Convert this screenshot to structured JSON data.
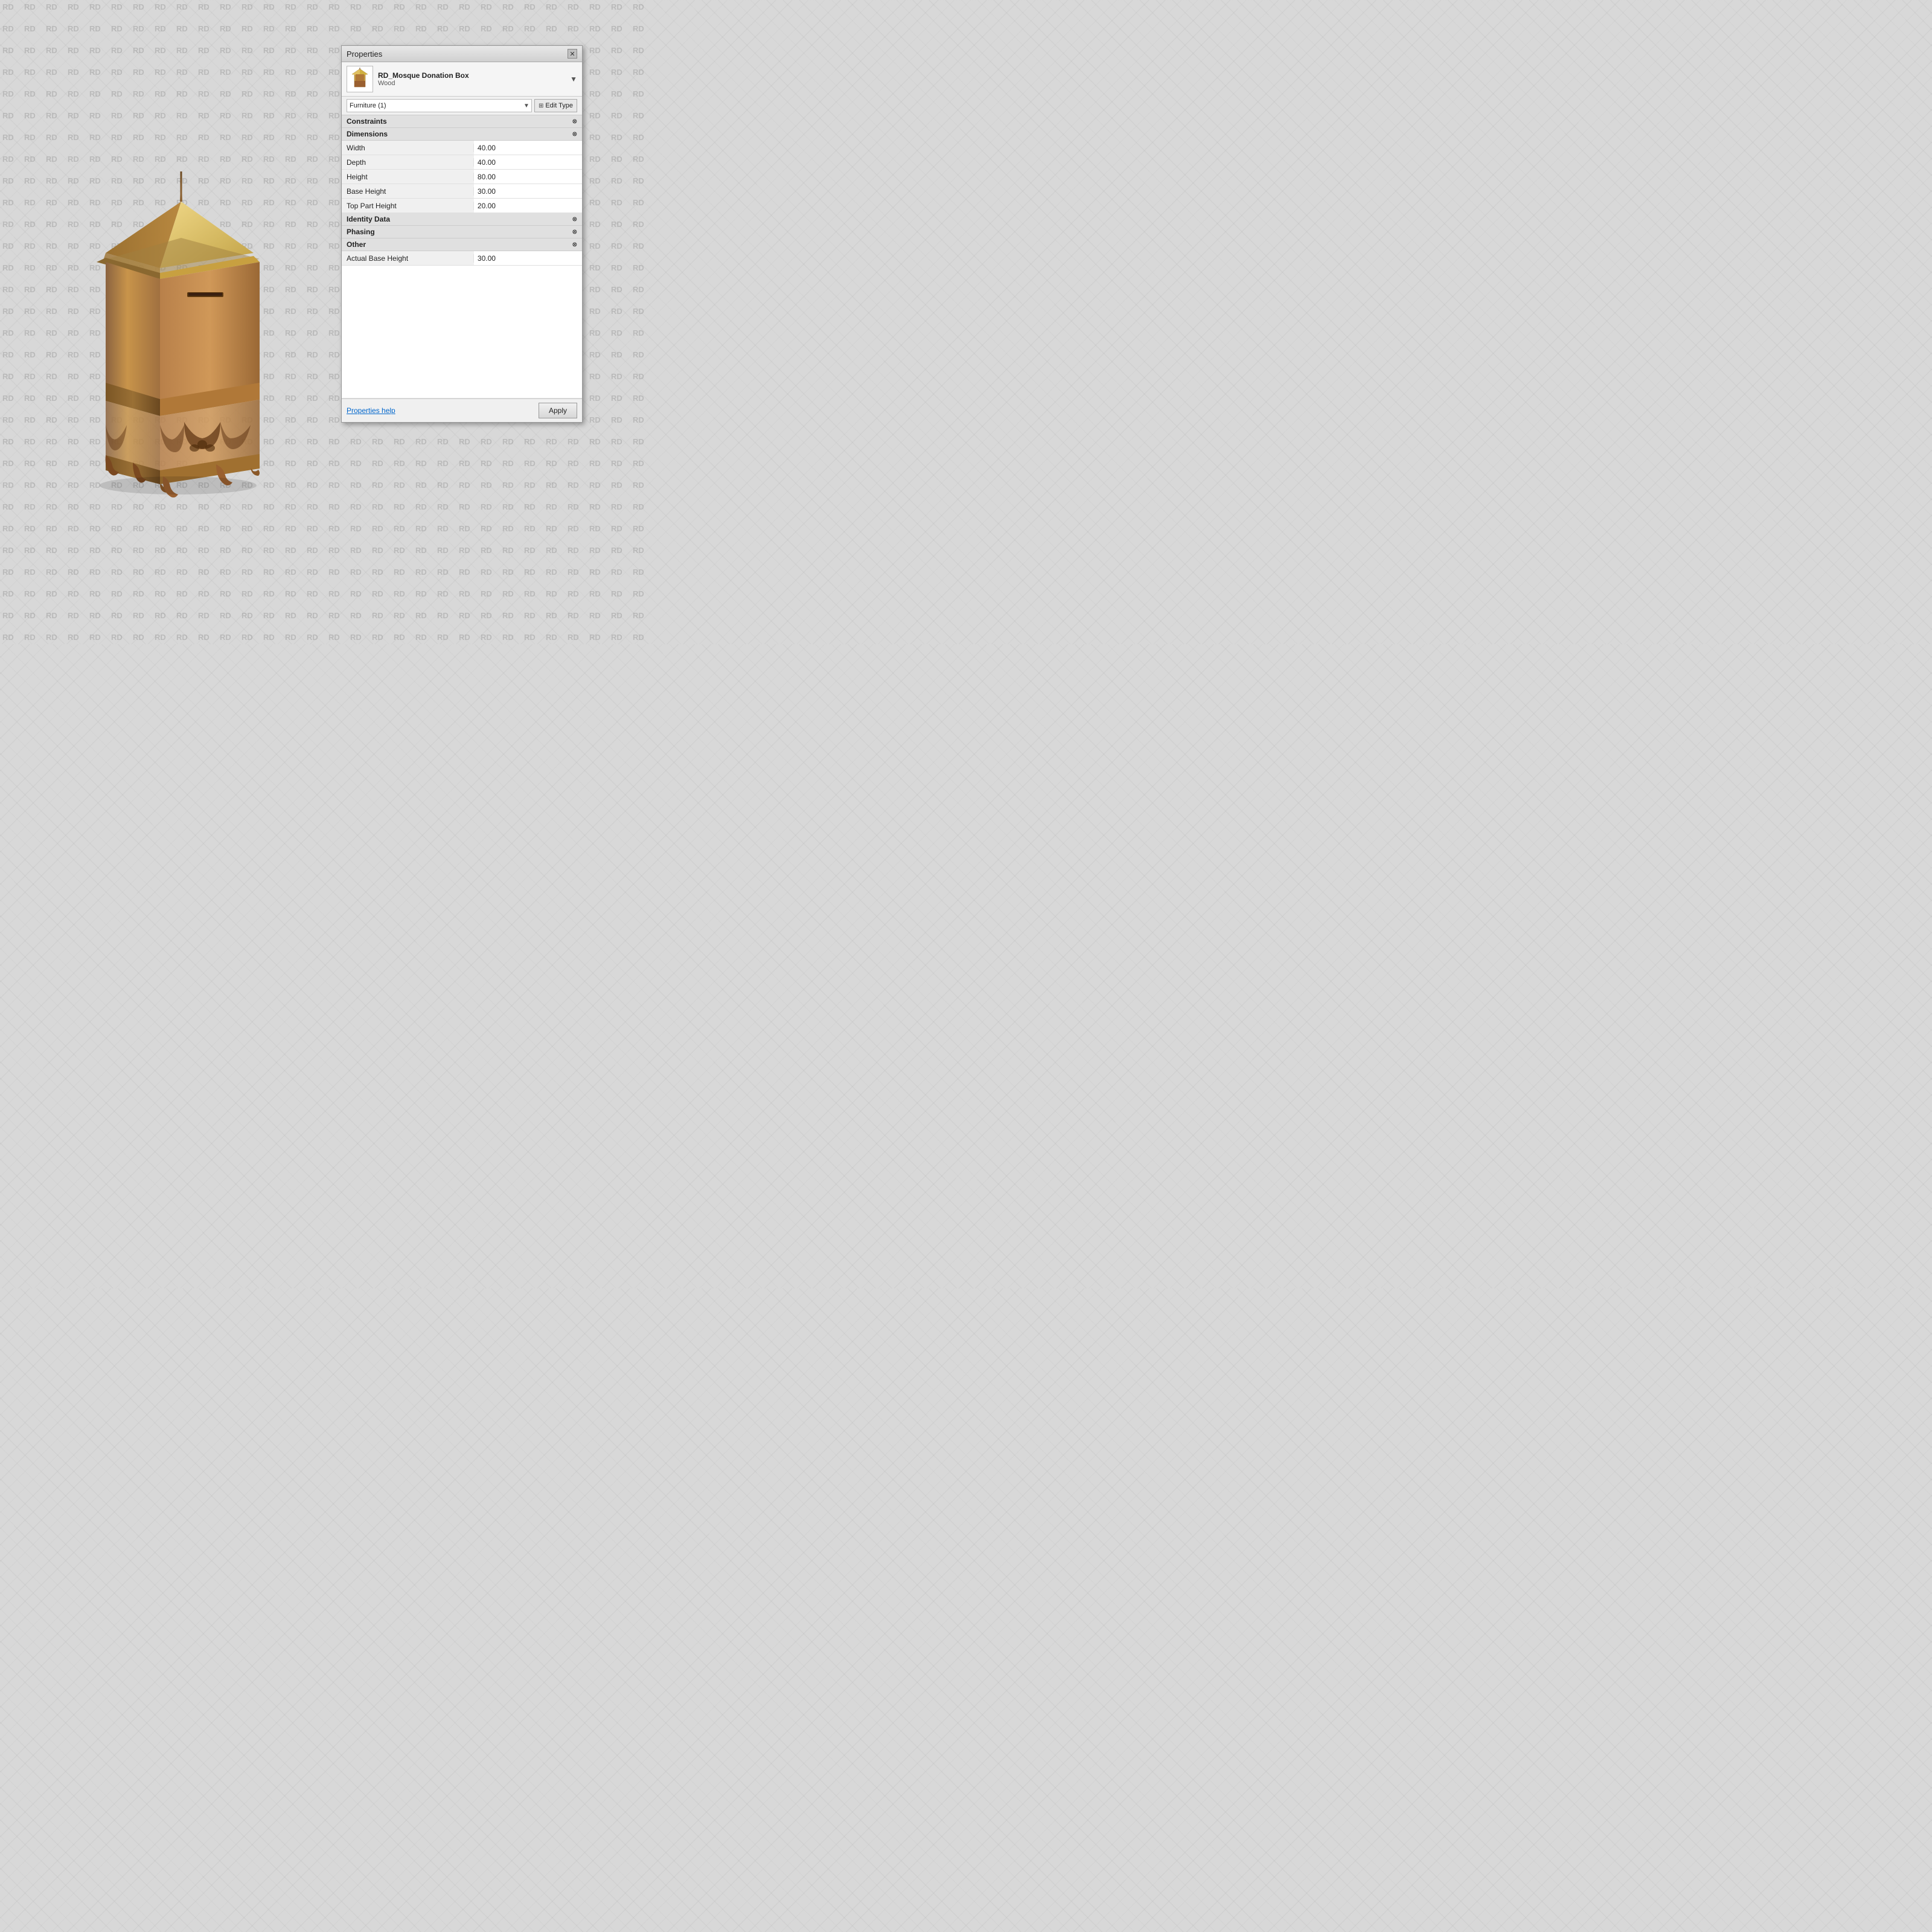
{
  "panel": {
    "title": "Properties",
    "object_name": "RD_Mosque Donation Box",
    "object_material": "Wood",
    "category": "Furniture (1)",
    "edit_type_label": "Edit Type",
    "sections": {
      "constraints": {
        "label": "Constraints",
        "collapsed": false
      },
      "dimensions": {
        "label": "Dimensions",
        "collapsed": false,
        "properties": [
          {
            "label": "Width",
            "value": "40.00"
          },
          {
            "label": "Depth",
            "value": "40.00"
          },
          {
            "label": "Height",
            "value": "80.00"
          },
          {
            "label": "Base Height",
            "value": "30.00"
          },
          {
            "label": "Top Part Height",
            "value": "20.00"
          }
        ]
      },
      "identity_data": {
        "label": "Identity Data",
        "collapsed": false
      },
      "phasing": {
        "label": "Phasing",
        "collapsed": false
      },
      "other": {
        "label": "Other",
        "collapsed": false,
        "properties": [
          {
            "label": "Actual Base Height",
            "value": "30.00"
          }
        ]
      }
    },
    "footer": {
      "help_link": "Properties help",
      "apply_label": "Apply"
    }
  },
  "watermark": {
    "text": "RD"
  },
  "colors": {
    "panel_bg": "#f0f0f0",
    "titlebar": "#d8d8d8",
    "section_header": "#e0e0e0",
    "accent_blue": "#0066cc",
    "apply_btn": "#d8d8d8"
  }
}
